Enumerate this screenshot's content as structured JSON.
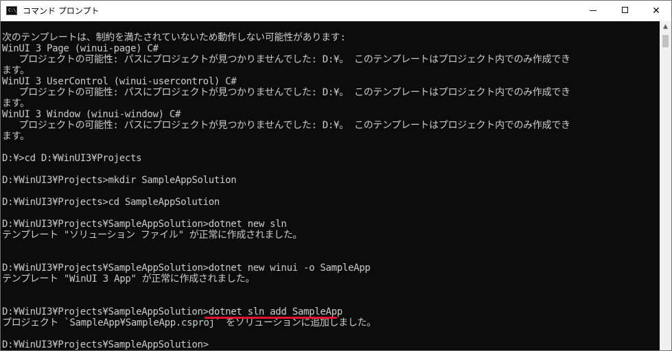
{
  "window": {
    "title": "コマンド プロンプト",
    "icon_text": "C:\\_",
    "controls": {
      "minimize": "minimize",
      "maximize": "maximize",
      "close": "✕"
    }
  },
  "console": {
    "lines": [
      "次のテンプレートは、制約を満たされていないため動作しない可能性があります:",
      "WinUI 3 Page (winui-page) C#",
      "   プロジェクトの可能性: パスにプロジェクトが見つかりませんでした: D:¥。 このテンプレートはプロジェクト内でのみ作成でき",
      "ます。",
      "WinUI 3 UserControl (winui-usercontrol) C#",
      "   プロジェクトの可能性: パスにプロジェクトが見つかりませんでした: D:¥。 このテンプレートはプロジェクト内でのみ作成でき",
      "ます。",
      "WinUI 3 Window (winui-window) C#",
      "   プロジェクトの可能性: パスにプロジェクトが見つかりませんでした: D:¥。 このテンプレートはプロジェクト内でのみ作成でき",
      "ます。",
      "",
      "D:¥>cd D:¥WinUI3¥Projects",
      "",
      "D:¥WinUI3¥Projects>mkdir SampleAppSolution",
      "",
      "D:¥WinUI3¥Projects>cd SampleAppSolution",
      "",
      "D:¥WinUI3¥Projects¥SampleAppSolution>dotnet new sln",
      "テンプレート \"ソリューション ファイル\" が正常に作成されました。",
      "",
      "",
      "D:¥WinUI3¥Projects¥SampleAppSolution>dotnet new winui -o SampleApp",
      "テンプレート \"WinUI 3 App\" が正常に作成されました。",
      "",
      "",
      "D:¥WinUI3¥Projects¥SampleAppSolution>dotnet sln add SampleApp",
      "プロジェクト `SampleApp¥SampleApp.csproj` をソリューションに追加しました。",
      "",
      "D:¥WinUI3¥Projects¥SampleAppSolution>"
    ]
  },
  "annotation": {
    "color": "#e8112d"
  },
  "scrollbar": {
    "up_arrow": "▲"
  }
}
